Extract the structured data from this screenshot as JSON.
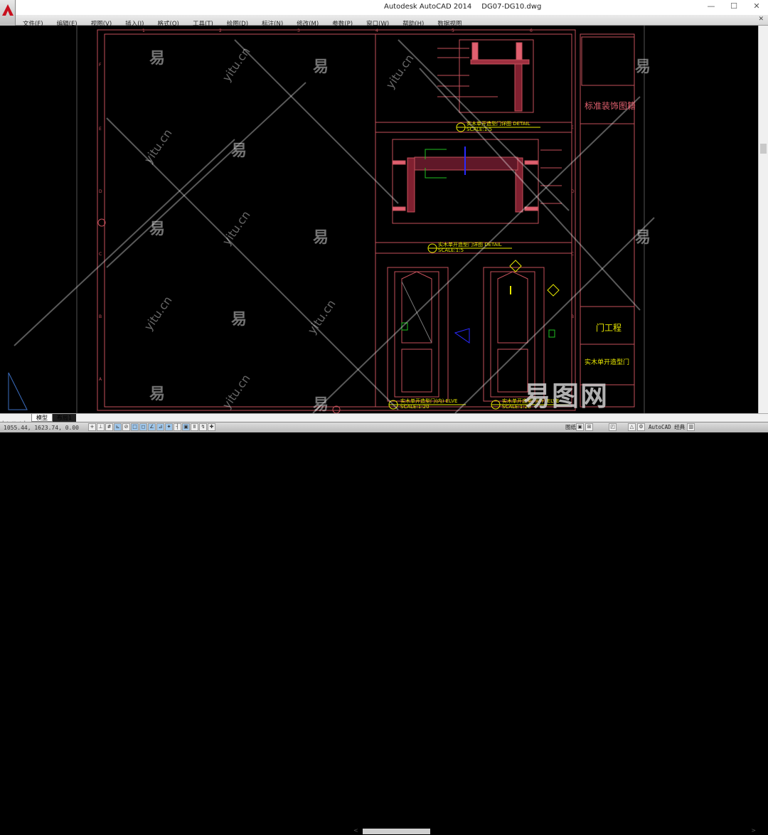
{
  "window": {
    "app": "Autodesk AutoCAD 2014",
    "file": "DG07-DG10.dwg",
    "minimize": "—",
    "maximize": "☐",
    "close": "✕"
  },
  "menu": [
    "文件(F)",
    "编辑(E)",
    "视图(V)",
    "插入(I)",
    "格式(O)",
    "工具(T)",
    "绘图(D)",
    "标注(N)",
    "修改(M)",
    "参数(P)",
    "窗口(W)",
    "帮助(H)",
    "数据视图"
  ],
  "menu_close": "✕",
  "drawing": {
    "title_block_title": "标准装饰图籍",
    "project": "门工程",
    "drawing_name": "实木单开造型门",
    "detail1": {
      "num": "B",
      "title": "实木单开造型门详图  DETAIL",
      "scale": "SCALE:1:5"
    },
    "detail2": {
      "num": "A",
      "title": "实木单开造型门详图  DETAIL",
      "scale": "SCALE:1:5"
    },
    "elev1": {
      "num": "2",
      "title": "实木单开造型门(内)   ELVE",
      "scale": "SCALE:1:20"
    },
    "elev2": {
      "num": "1",
      "title": "实木单开造型门(外)   ELVE",
      "scale": "SCALE:1:20"
    },
    "col_labels": [
      "1",
      "2",
      "3",
      "4",
      "5",
      "6"
    ],
    "row_labels": [
      "F",
      "E",
      "D",
      "C",
      "B",
      "A"
    ],
    "row_labels_right": [
      "E",
      "D",
      "C",
      "B"
    ]
  },
  "watermark": {
    "char": "易",
    "site": "yitu.cn",
    "logo": "易图网"
  },
  "tabs": {
    "nav": "|◀ ◀ ▶ ▶|",
    "model": "模型",
    "layout": "布局1"
  },
  "hscroll": {
    "left": "<",
    "right": ">"
  },
  "status": {
    "coords": "1055.44, 1623.74, 0.00",
    "mode_icons": [
      "+",
      "⊥",
      "#",
      "⊾",
      "⊘",
      "□",
      "◻",
      "∠",
      "⊿",
      "✦",
      "┤",
      "▣",
      "Ⅱ",
      "↯",
      "✚"
    ],
    "model_label": "图纸",
    "workspace": "AutoCAD 经典",
    "right_icons": [
      "▣",
      "⊞",
      "◰",
      "△",
      "⚙",
      "▥"
    ]
  },
  "colors": {
    "frame": "#c4505a",
    "yellow": "#e8e800",
    "green": "#20c020",
    "blue": "#2a2aff"
  }
}
